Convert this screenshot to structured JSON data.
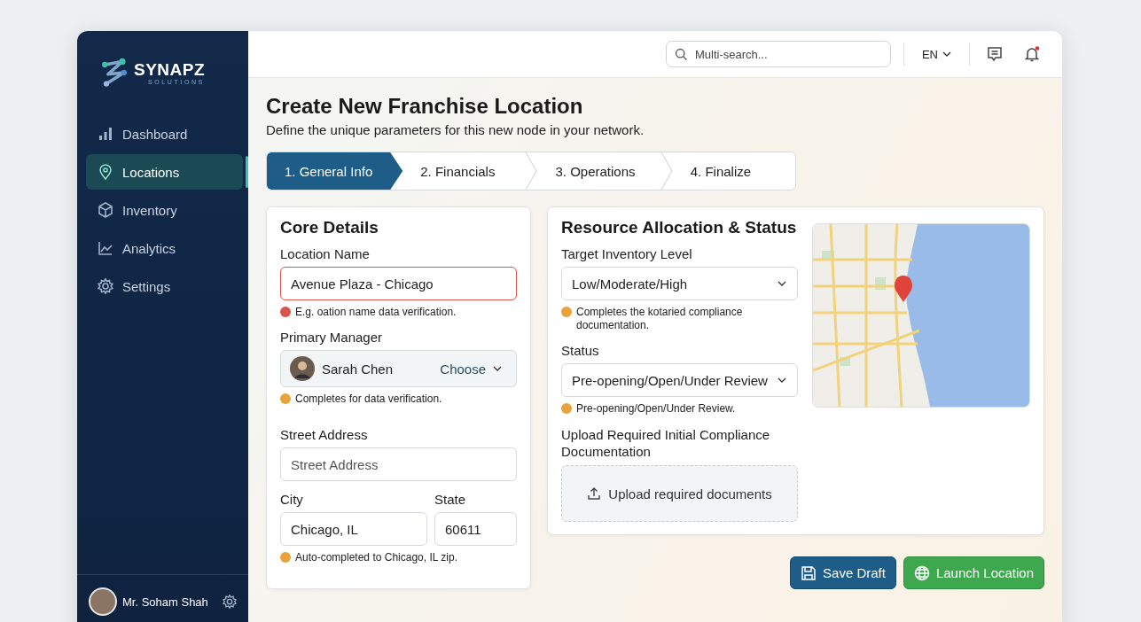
{
  "brand": {
    "name": "SYNAPZ",
    "tagline": "SOLUTIONS"
  },
  "sidebar": {
    "items": [
      {
        "label": "Dashboard",
        "kind": "bars",
        "selected": false
      },
      {
        "label": "Locations",
        "kind": "pin",
        "selected": true
      },
      {
        "label": "Inventory",
        "kind": "box",
        "selected": false
      },
      {
        "label": "Analytics",
        "kind": "trend",
        "selected": false
      },
      {
        "label": "Settings",
        "kind": "gear",
        "selected": false
      }
    ]
  },
  "user": {
    "name": "Mr. Soham Shah"
  },
  "topbar": {
    "search": {
      "placeholder": "Multi-search..."
    },
    "language": "EN",
    "notifications_unread": true
  },
  "page": {
    "title": "Create New Franchise Location",
    "subtitle": "Define the unique parameters for this new node in your network."
  },
  "steps": [
    {
      "label": "1. General Info",
      "selected": true
    },
    {
      "label": "2. Financials",
      "selected": false
    },
    {
      "label": "3. Operations",
      "selected": false
    },
    {
      "label": "4. Finalize",
      "selected": false
    }
  ],
  "core_details": {
    "title": "Core Details",
    "location_name": {
      "label": "Location Name",
      "value": "Avenue Plaza - Chicago",
      "hint": {
        "text": "E.g. oation name data verification.",
        "color": "#d9534f"
      }
    },
    "primary_manager": {
      "label": "Primary Manager",
      "value": "Sarah Chen",
      "action": "Choose",
      "hint": {
        "text": "Completes for data verification.",
        "color": "#e8a33a"
      }
    },
    "street_address": {
      "label": "Street Address",
      "placeholder": "Street Address"
    },
    "city": {
      "label": "City",
      "value": "Chicago, IL"
    },
    "state": {
      "label": "State",
      "value": "60611"
    },
    "location_hint": {
      "text": "Auto-completed to Chicago, IL zip.",
      "color": "#e8a33a"
    }
  },
  "resource_allocation": {
    "title": "Resource Allocation & Status",
    "target_inventory": {
      "label": "Target Inventory Level",
      "value": "Low/Moderate/High",
      "hint": {
        "text": "Completes the kotaried compliance documentation.",
        "color": "#e8a33a"
      }
    },
    "status": {
      "label": "Status",
      "value": "Pre-opening/Open/Under Review",
      "hint": {
        "text": "Pre-opening/Open/Under Review.",
        "color": "#e8a33a"
      }
    },
    "upload": {
      "label": "Upload Required Initial Compliance Documentation",
      "button": "Upload required documents"
    }
  },
  "buttons": [
    {
      "label": "Save Draft",
      "kind": "save"
    },
    {
      "label": "Launch Location",
      "kind": "launch"
    }
  ]
}
